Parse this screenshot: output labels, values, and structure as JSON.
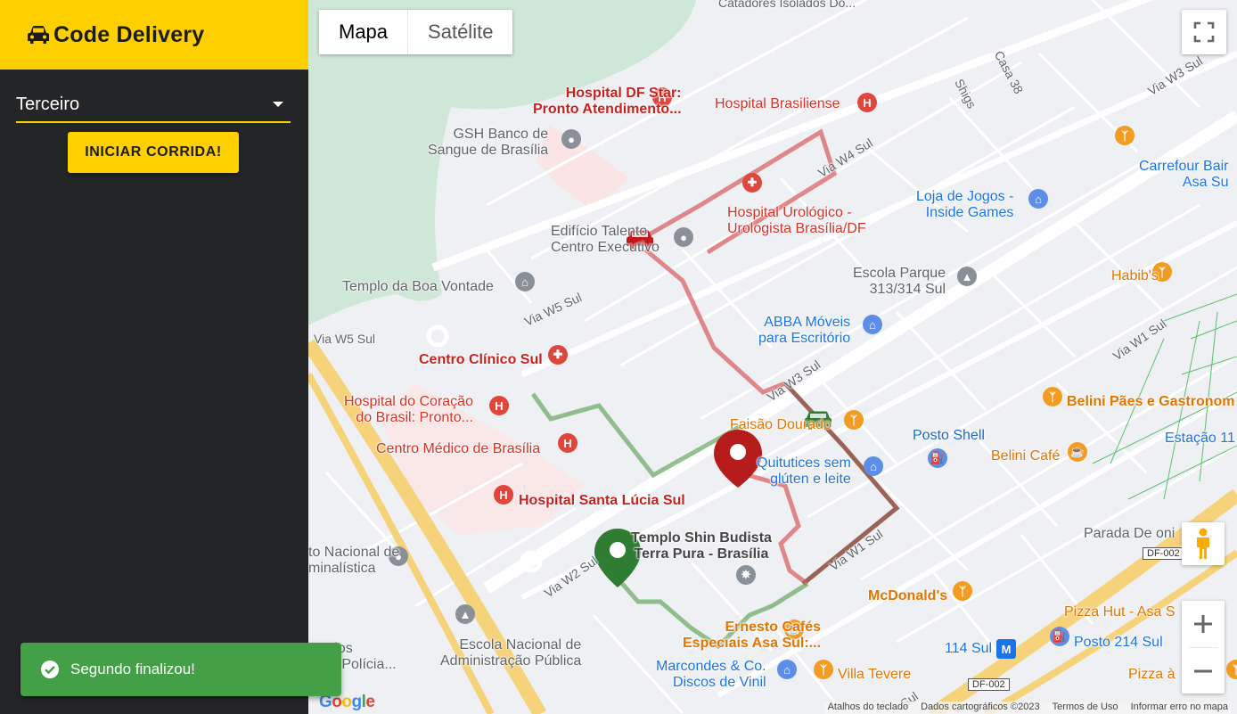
{
  "app": {
    "title": "Code Delivery"
  },
  "route_select": {
    "value": "Terceiro"
  },
  "start_button": {
    "label": "INICIAR CORRIDA!"
  },
  "toast": {
    "message": "Segundo finalizou!"
  },
  "map": {
    "type_controls": {
      "map_label": "Mapa",
      "satellite_label": "Satélite"
    },
    "labels": {
      "catadores": "Catadores Isolados Do...",
      "casa38": "Casa 38",
      "shigs": "Shigs",
      "via_w3_sul_top": "Via W3 Sul",
      "hospital_df_star": "Hospital DF Star:\nPronto Atendimento...",
      "hospital_brasiliense": "Hospital Brasiliense",
      "gsh": "GSH Banco de\nSangue de Brasília",
      "via_w4_sul": "Via W4 Sul",
      "carrefour": "Carrefour Bair\nAsa Su",
      "loja_jogos": "Loja de Jogos -\nInside Games",
      "edificio": "Edifício Talento\nCentro Executivo",
      "hospital_urologico": "Hospital Urológico -\nUrologista Brasília/DF",
      "escola_parque": "Escola Parque\n313/314 Sul",
      "habibs": "Habib's",
      "templo_boa_vontade": "Templo da Boa Vontade",
      "via_w5_sul": "Via W5 Sul",
      "via_w5_sul_2": "Via W5 Sul",
      "abba": "ABBA Móveis\npara Escritório",
      "via_w1_sul_right": "Via W1 Sul",
      "centro_clinico": "Centro Clínico Sul",
      "via_w3_sul_mid": "Via W3 Sul",
      "belini_paes": "Belini Pães e Gastronom",
      "hospital_coracao": "Hospital do Coração\ndo Brasil: Pronto...",
      "faisao": "Faisão Dourado",
      "posto_shell": "Posto Shell",
      "estacao": "Estação 11",
      "centro_medico": "Centro Médico de Brasília",
      "quitutices": "Quitutices sem\nglúten e leite",
      "belini_cafe": "Belini Café",
      "hospital_santa_lucia": "Hospital Santa Lúcia Sul",
      "templo_shin": "Templo Shin Budista\nTerra Pura - Brasília",
      "via_w1_sul": "Via W1 Sul",
      "parada": "Parada De oni",
      "df002_top": "DF-002",
      "instituto": "to Nacional de\nminalística",
      "via_w2_sul": "Via W2 Sul",
      "mcdonalds": "McDonald's",
      "pizza_hut": "Pizza Hut - Asa S",
      "ernesto": "Ernesto Cafés\nEspeciais Asa Sul:...",
      "escola_nacional": "Escola Nacional de\nAdministração Pública",
      "dos_policia": "dos\na Polícia...",
      "marcondes": "Marcondes & Co.\nDiscos de Vinil",
      "villa_tevere": "Villa Tevere",
      "sul_114": "114 Sul",
      "posto_214": "Posto 214 Sul",
      "pizza_a": "Pizza à",
      "df002_bottom": "DF-002",
      "sul_bottom": "Sul"
    },
    "footer": {
      "google": "Google",
      "keyboard": "Atalhos do teclado",
      "map_data": "Dados cartográficos ©2023",
      "terms": "Termos de Uso",
      "report": "Informar erro no mapa"
    },
    "colors": {
      "route_red": "#d9595c",
      "route_green": "#6fae6a",
      "route_brown": "#8b4a3a",
      "marker_red": "#b71c1c",
      "marker_green": "#2e7d32",
      "accent": "#ffd000"
    }
  }
}
